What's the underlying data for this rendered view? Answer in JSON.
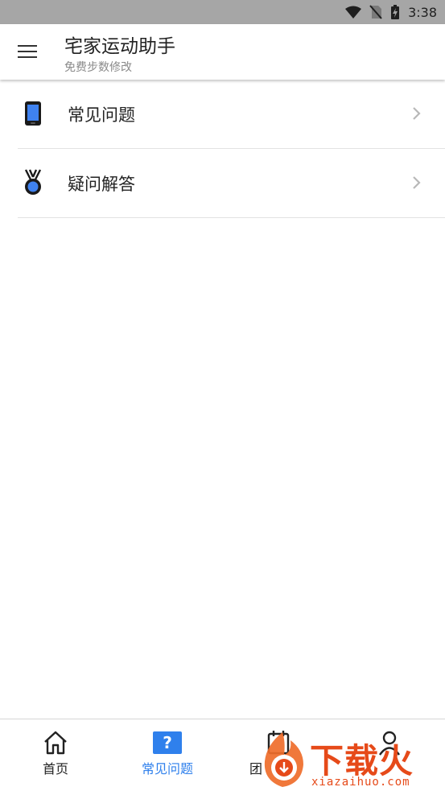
{
  "status_bar": {
    "time": "3:38"
  },
  "app_bar": {
    "title": "宅家运动助手",
    "subtitle": "免费步数修改"
  },
  "list": {
    "items": [
      {
        "label": "常见问题",
        "icon": "phone-icon"
      },
      {
        "label": "疑问解答",
        "icon": "medal-icon"
      }
    ]
  },
  "bottom_nav": {
    "items": [
      {
        "label": "首页",
        "icon": "home-icon"
      },
      {
        "label": "常见问题",
        "icon": "question-icon",
        "active": true
      },
      {
        "label": "团",
        "icon": "calendar-icon"
      },
      {
        "label": "",
        "icon": "profile-icon"
      }
    ]
  },
  "watermark": {
    "text": "下载火",
    "url": "xiazaihuo.com"
  },
  "colors": {
    "accent": "#2f80ec",
    "status_bar": "#a6a6a6",
    "watermark": "#e64a19"
  }
}
